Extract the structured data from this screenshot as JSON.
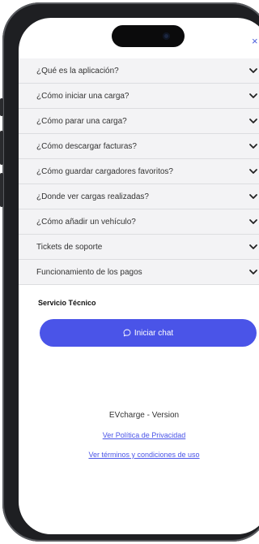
{
  "header": {
    "close_icon": "close-icon",
    "close_glyph": "×"
  },
  "faq": {
    "items": [
      {
        "label": "¿Qué es la aplicación?"
      },
      {
        "label": "¿Cómo iniciar una carga?"
      },
      {
        "label": "¿Cómo parar una carga?"
      },
      {
        "label": "¿Cómo descargar facturas?"
      },
      {
        "label": "¿Cómo guardar cargadores favoritos?"
      },
      {
        "label": "¿Donde ver cargas realizadas?"
      },
      {
        "label": "¿Cómo añadir un vehículo?"
      },
      {
        "label": "Tickets de soporte"
      },
      {
        "label": "Funcionamiento de los pagos"
      }
    ],
    "chevron_icon": "chevron-down-icon"
  },
  "support": {
    "title": "Servicio Técnico",
    "chat_button_label": "Iniciar chat",
    "chat_icon": "chat-bubble-icon"
  },
  "footer": {
    "version": "EVcharge - Version",
    "privacy_link": "Ver Política de Privacidad",
    "terms_link": "Ver términos y condiciones de uso"
  },
  "colors": {
    "accent": "#4a54e8",
    "list_background": "#f3f3f5",
    "text": "#333333"
  }
}
